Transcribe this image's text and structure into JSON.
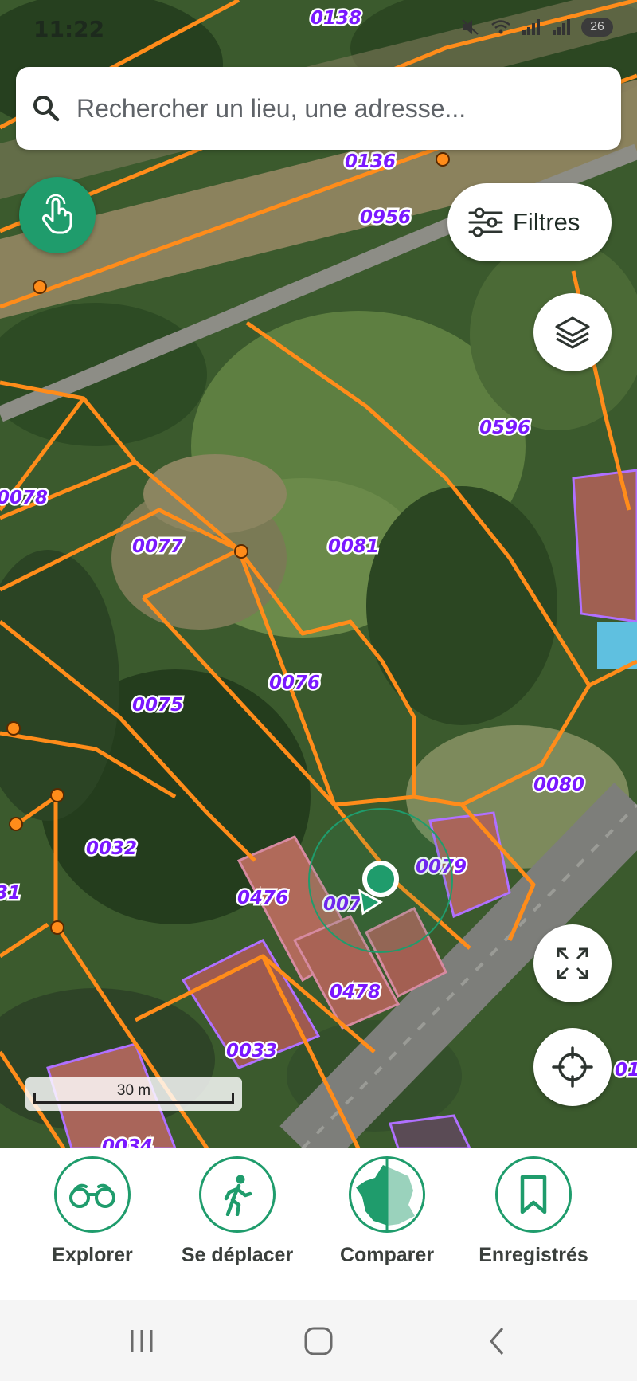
{
  "status_bar": {
    "time": "11:22",
    "battery": "26"
  },
  "search": {
    "placeholder": "Rechercher un lieu, une adresse..."
  },
  "filters": {
    "label": "Filtres"
  },
  "scale": {
    "label": "30 m"
  },
  "parcels": [
    "0138",
    "0136",
    "0956",
    "0596",
    "0078",
    "0077",
    "0081",
    "0076",
    "0075",
    "0080",
    "0032",
    "0079",
    "0476",
    "007",
    "31",
    "0478",
    "0033",
    "0034",
    "01"
  ],
  "nav": [
    {
      "label": "Explorer",
      "icon": "binoculars-icon"
    },
    {
      "label": "Se déplacer",
      "icon": "walking-person-icon"
    },
    {
      "label": "Comparer",
      "icon": "france-map-icon"
    },
    {
      "label": "Enregistrés",
      "icon": "bookmark-icon"
    }
  ],
  "colors": {
    "accent": "#1f9c6c",
    "parcel_line": "#ff8c1a",
    "parcel_label": "#7a18ff",
    "building_outline": "#b070ff"
  }
}
